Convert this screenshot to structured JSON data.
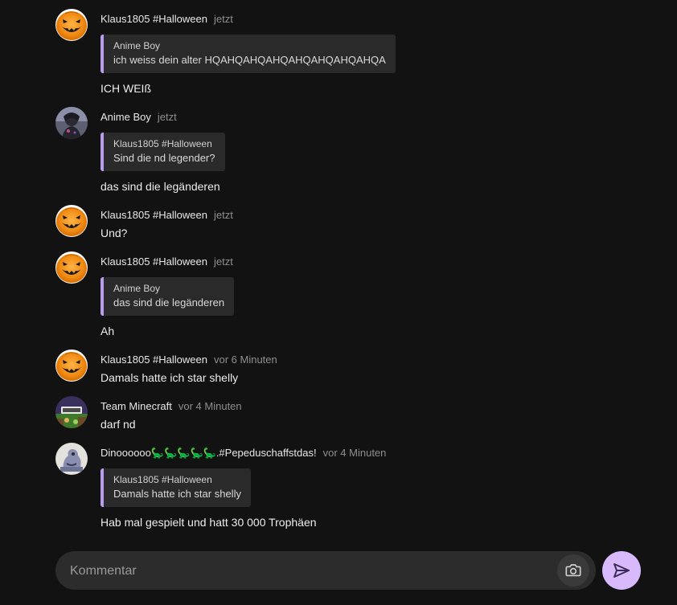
{
  "messages": [
    {
      "author": "Klaus1805 #Halloween",
      "time": "jetzt",
      "avatar": "pumpkin-avatar",
      "quote": {
        "author": "Anime Boy",
        "text": "ich weiss dein alter HQAHQAHQAHQAHQAHQAHQAHQA"
      },
      "text": "ICH WEIß"
    },
    {
      "author": "Anime Boy",
      "time": "jetzt",
      "avatar": "anime-avatar",
      "quote": {
        "author": "Klaus1805 #Halloween",
        "text": "Sind die nd legender?"
      },
      "text": "das sind die legänderen"
    },
    {
      "author": "Klaus1805 #Halloween",
      "time": "jetzt",
      "avatar": "pumpkin-avatar",
      "text": "Und?"
    },
    {
      "author": "Klaus1805 #Halloween",
      "time": "jetzt",
      "avatar": "pumpkin-avatar",
      "quote": {
        "author": "Anime Boy",
        "text": "das sind die legänderen"
      },
      "text": "Ah"
    },
    {
      "author": "Klaus1805 #Halloween",
      "time": "vor 6 Minuten",
      "avatar": "pumpkin-avatar",
      "text": "Damals hatte ich star shelly"
    },
    {
      "author": "Team Minecraft",
      "time": "vor 4 Minuten",
      "avatar": "minecraft-avatar",
      "text": "darf nd"
    },
    {
      "author": "Dinoooooo🦕🦕🦕🦕🦕.#Pepeduschaffstdas!",
      "time": "vor 4 Minuten",
      "avatar": "dino-avatar",
      "quote": {
        "author": "Klaus1805 #Halloween",
        "text": "Damals hatte ich star shelly"
      },
      "text": "Hab mal gespielt und hatt 30 000 Trophäen"
    }
  ],
  "composer": {
    "placeholder": "Kommentar",
    "value": "",
    "camera_icon": "camera-icon",
    "send_icon": "send-icon"
  },
  "colors": {
    "background": "#121212",
    "quote_accent": "#b99cf0",
    "send_button": "#d8b9fb",
    "bubble": "#2a2a2b"
  }
}
